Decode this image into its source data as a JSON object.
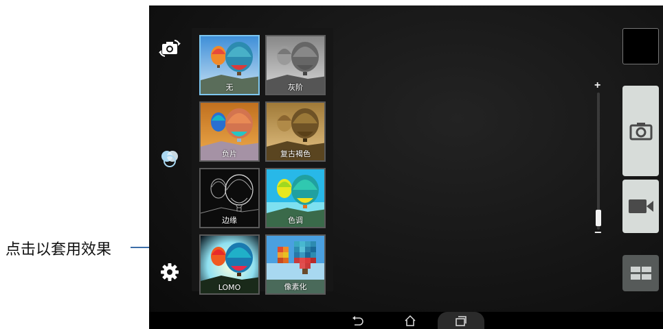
{
  "annotation": {
    "label": "点击以套用效果"
  },
  "left_toolbar": [
    {
      "name": "switch-camera",
      "icon": "switch-camera-icon"
    },
    {
      "name": "color-effects",
      "icon": "color-effects-icon"
    },
    {
      "name": "settings",
      "icon": "gear-icon"
    }
  ],
  "effects": [
    {
      "id": "none",
      "label": "无",
      "selected": true
    },
    {
      "id": "mono",
      "label": "灰阶",
      "selected": false
    },
    {
      "id": "negative",
      "label": "负片",
      "selected": false
    },
    {
      "id": "sepia",
      "label": "复古褐色",
      "selected": false
    },
    {
      "id": "sketch",
      "label": "边缘",
      "selected": false
    },
    {
      "id": "posterize",
      "label": "色调",
      "selected": false
    },
    {
      "id": "lomo",
      "label": "LOMO",
      "selected": false
    },
    {
      "id": "pixelate",
      "label": "像素化",
      "selected": false
    }
  ],
  "zoom": {
    "plus": "+",
    "minus": "−",
    "level": 0.05
  },
  "right_controls": {
    "shutter_icon": "camera-icon",
    "video_icon": "video-camera-icon",
    "mode_icon": "grid-mode-icon"
  },
  "navbar": {
    "back": "back-icon",
    "home": "home-icon",
    "recent": "recent-apps-icon"
  },
  "colors": {
    "accent": "#7ec7f0",
    "annotation_line": "#3b6ea8",
    "button_bg": "#d7dcd9"
  }
}
